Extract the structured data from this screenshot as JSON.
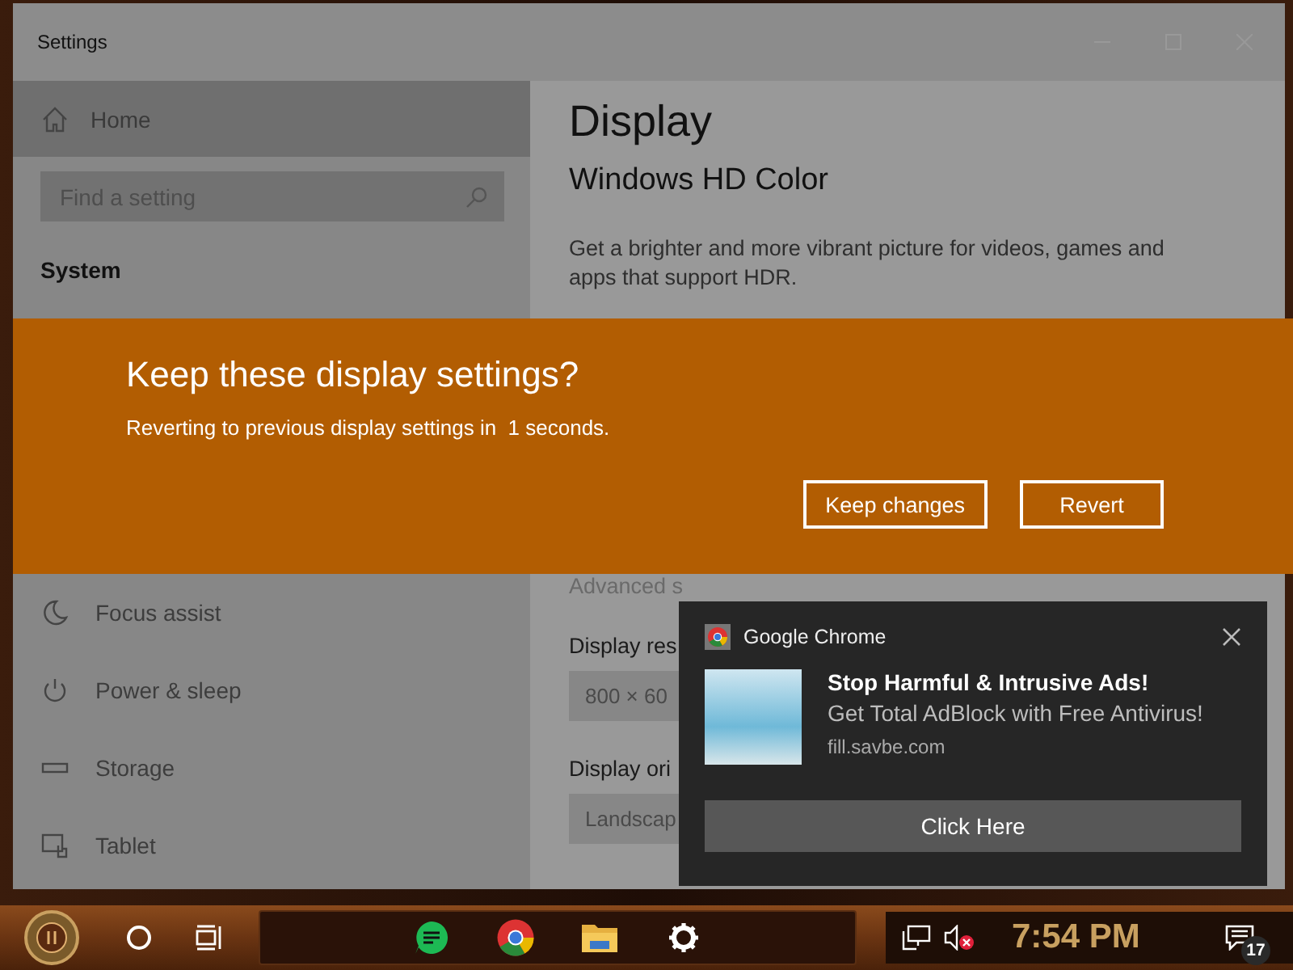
{
  "window": {
    "title": "Settings"
  },
  "sidebar": {
    "home": {
      "label": "Home",
      "selected": true
    },
    "search": {
      "placeholder": "Find a setting"
    },
    "section": "System",
    "items": [
      {
        "label": "Focus assist",
        "kind": "moon",
        "selected": false
      },
      {
        "label": "Power & sleep",
        "kind": "power",
        "selected": false
      },
      {
        "label": "Storage",
        "kind": "storage",
        "selected": false
      },
      {
        "label": "Tablet",
        "kind": "tablet",
        "selected": false
      }
    ]
  },
  "content": {
    "title": "Display",
    "section": "Windows HD Color",
    "description": "Get a brighter and more vibrant picture for videos, games and apps that support HDR.",
    "advanced_link": "Advanced s",
    "fields": [
      {
        "label": "Display res",
        "value": "800 × 60"
      },
      {
        "label": "Display ori",
        "value": "Landscap"
      }
    ]
  },
  "dialog": {
    "title": "Keep these display settings?",
    "message": "Reverting to previous display settings in  1 seconds.",
    "buttons": [
      "Keep changes",
      "Revert"
    ]
  },
  "notification": {
    "app": "Google Chrome",
    "title": "Stop Harmful & Intrusive Ads!",
    "body": "Get Total AdBlock with Free Antivirus!",
    "source": "fill.savbe.com",
    "button": "Click Here"
  },
  "taskbar": {
    "clock": "7:54 PM",
    "notification_count": "17",
    "volume_muted": true
  }
}
